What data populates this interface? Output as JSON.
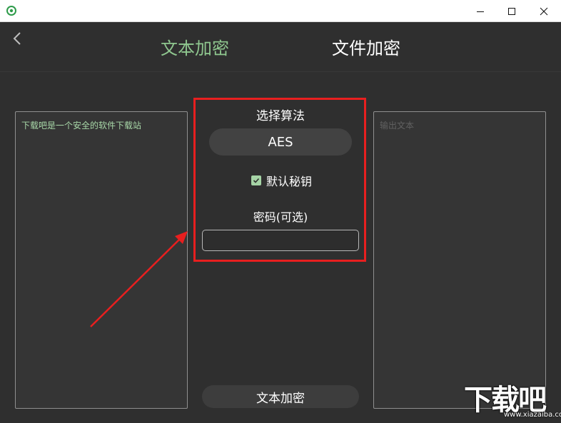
{
  "window": {
    "minimize_icon": "minimize-icon",
    "maximize_icon": "maximize-icon",
    "close_icon": "close-icon"
  },
  "tabs": {
    "text_encrypt": "文本加密",
    "file_encrypt": "文件加密",
    "active": "text_encrypt",
    "active_color": "#8fc78f"
  },
  "input_panel": {
    "text": "下载吧是一个安全的软件下载站"
  },
  "output_panel": {
    "placeholder": "输出文本"
  },
  "algorithm": {
    "title": "选择算法",
    "selected": "AES"
  },
  "default_key": {
    "label": "默认秘钥",
    "checked": true
  },
  "password": {
    "label": "密码(可选)",
    "value": ""
  },
  "action": {
    "encrypt_label": "文本加密"
  },
  "watermark": {
    "brand": "下载吧",
    "url": "www.xiazaiba.com"
  },
  "annotation": {
    "highlight_color": "#e81f1f"
  }
}
